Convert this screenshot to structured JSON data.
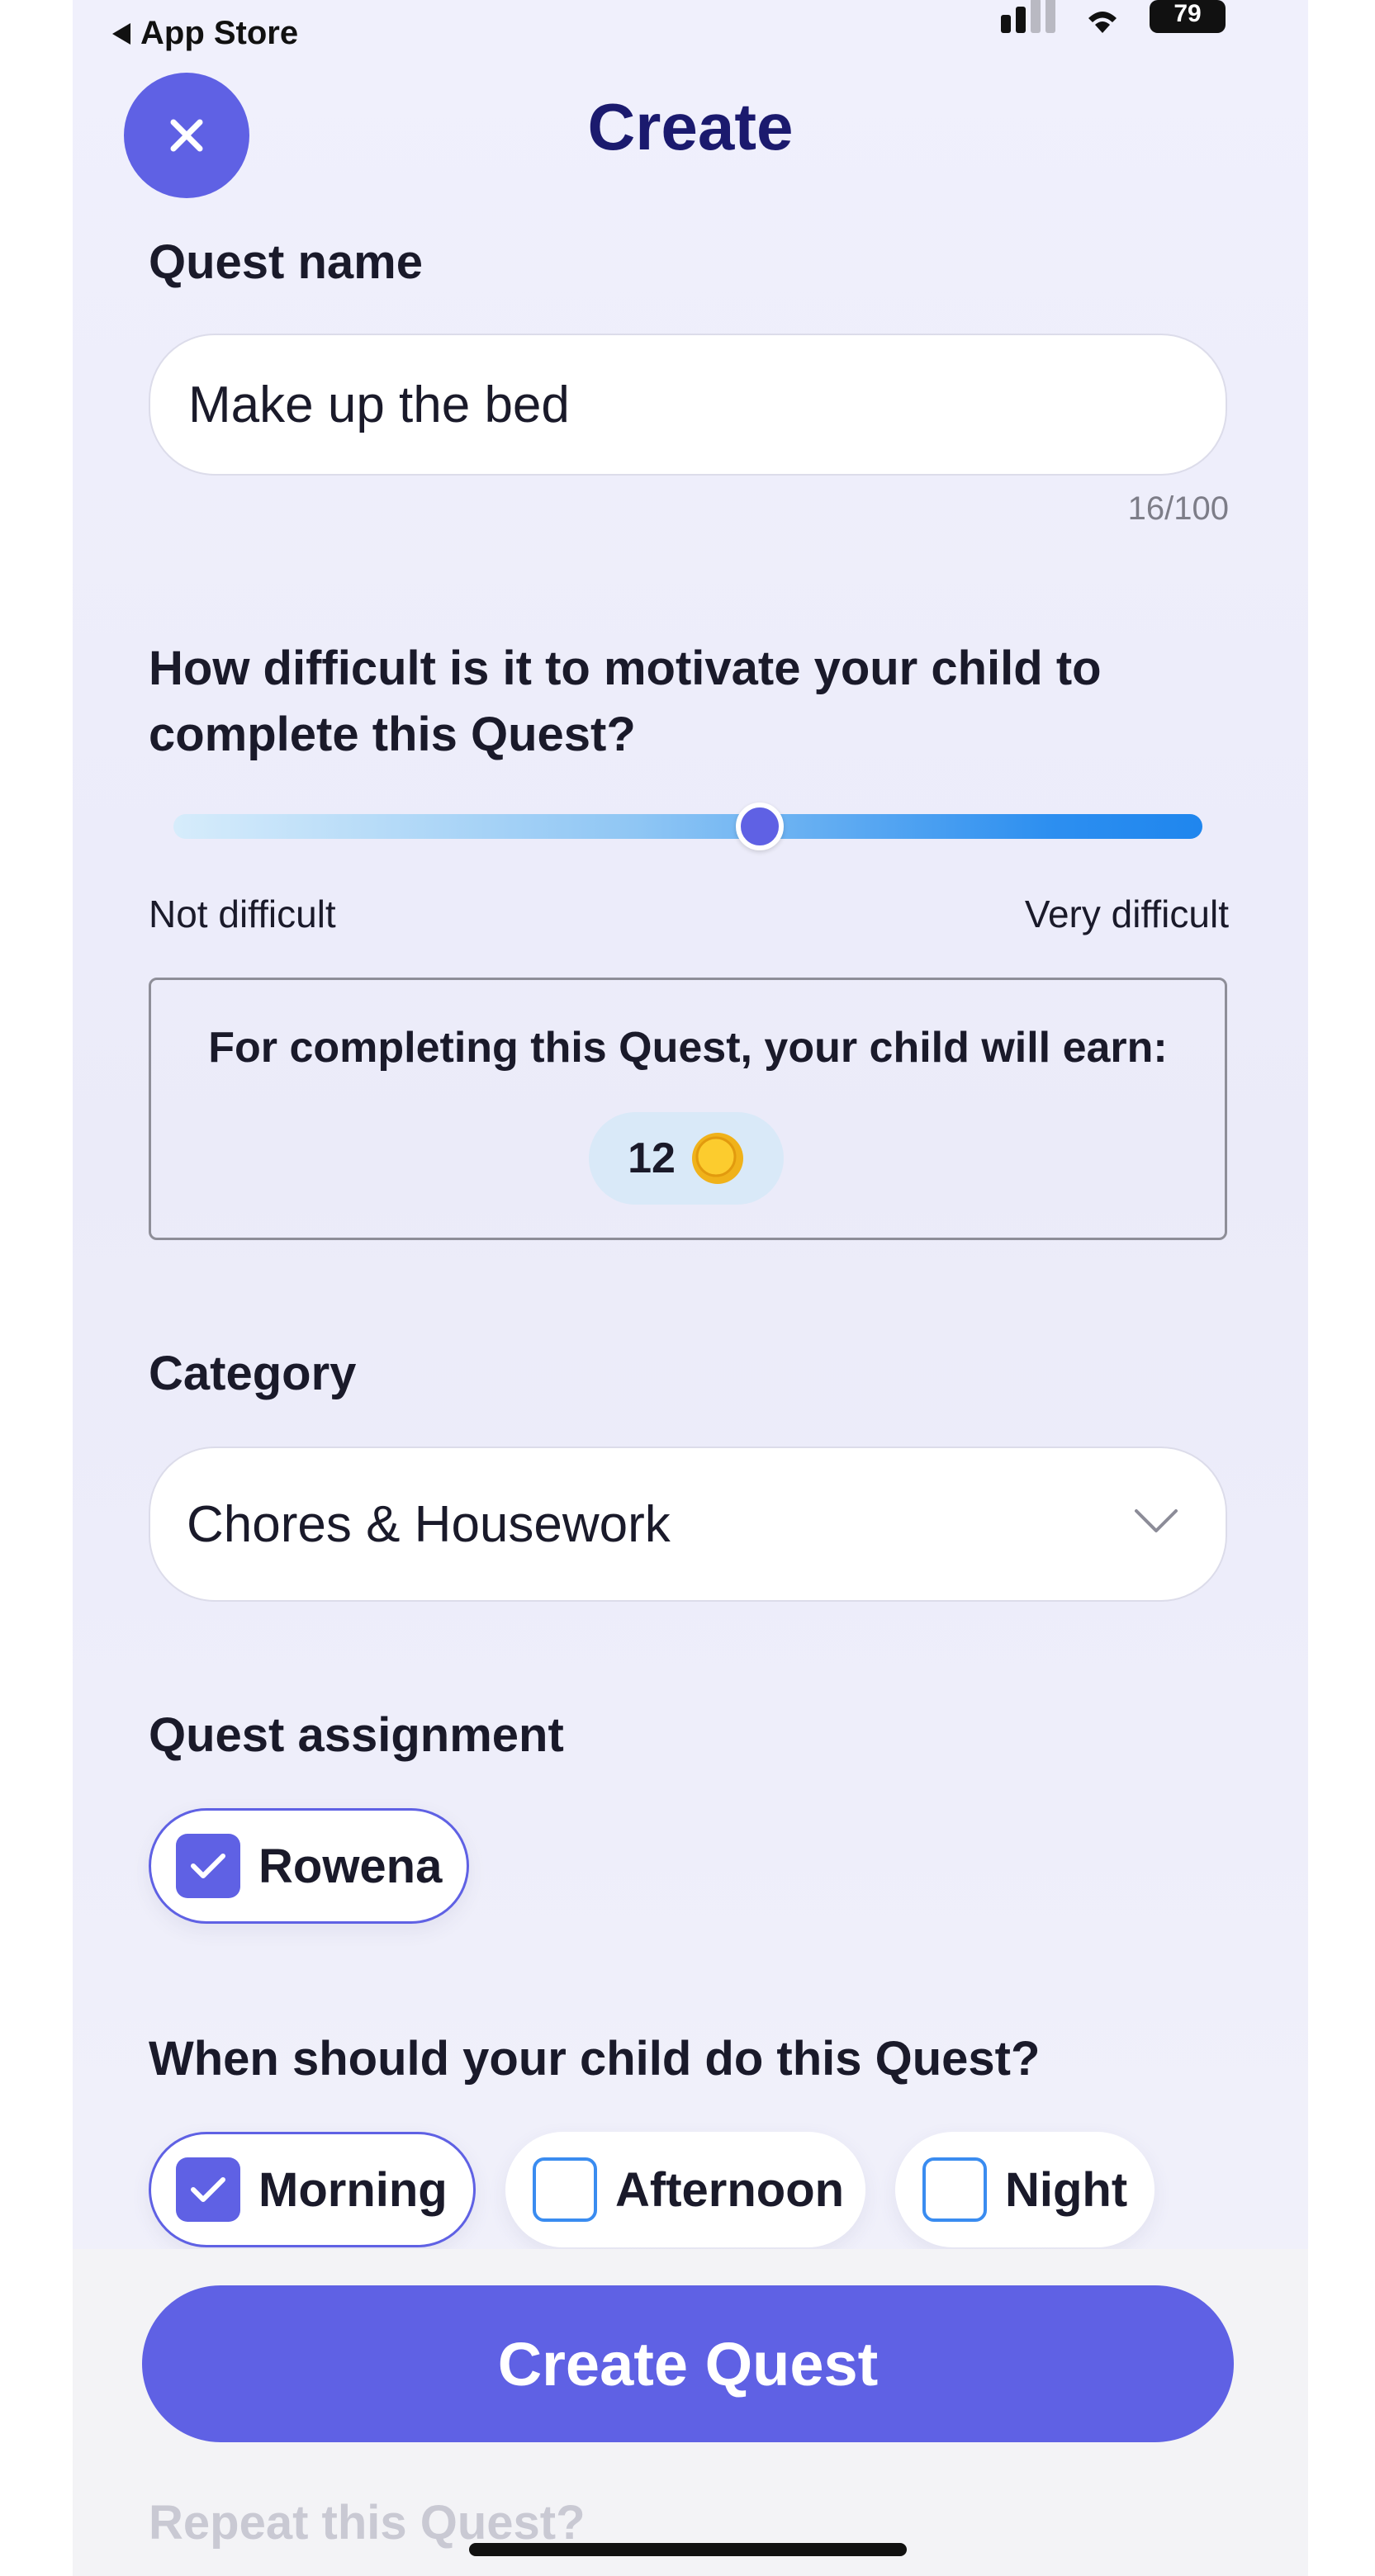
{
  "status_bar": {
    "back_label": "App Store",
    "battery": "79"
  },
  "header": {
    "title": "Create"
  },
  "quest_name": {
    "label": "Quest name",
    "value": "Make up the bed",
    "counter": "16/100"
  },
  "difficulty": {
    "question": "How difficult is it to motivate your child to complete this Quest?",
    "value_fraction": 0.57,
    "min_label": "Not difficult",
    "max_label": "Very difficult"
  },
  "reward": {
    "text": "For completing this Quest, your child will earn:",
    "coins": "12",
    "coin_icon": "coin-icon"
  },
  "category": {
    "label": "Category",
    "selected": "Chores & Housework"
  },
  "assignment": {
    "label": "Quest assignment",
    "children": [
      {
        "name": "Rowena",
        "checked": true
      }
    ]
  },
  "time_of_day": {
    "question": "When should your child do this Quest?",
    "options": [
      {
        "label": "Morning",
        "checked": true
      },
      {
        "label": "Afternoon",
        "checked": false
      },
      {
        "label": "Night",
        "checked": false
      }
    ]
  },
  "footer": {
    "create_button": "Create Quest",
    "next_section_label": "Repeat this Quest?"
  },
  "colors": {
    "accent": "#5f61e4",
    "title": "#1b1a6e",
    "background": "#efeffb"
  }
}
